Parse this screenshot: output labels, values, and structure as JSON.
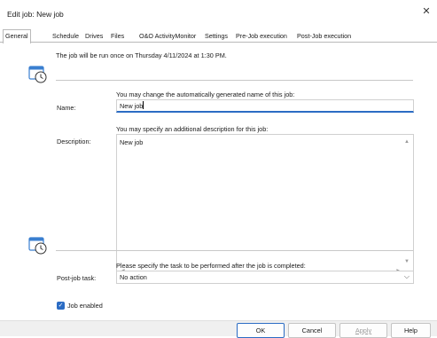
{
  "window": {
    "title": "Edit job: New job",
    "close_glyph": "✕"
  },
  "tabs": [
    {
      "label": "General",
      "active": true
    },
    {
      "label": "Schedule"
    },
    {
      "label": "Drives"
    },
    {
      "label": "Files"
    },
    {
      "label": "O&O ActivityMonitor"
    },
    {
      "label": "Settings"
    },
    {
      "label": "Pre-Job execution"
    },
    {
      "label": "Post-Job execution"
    }
  ],
  "general": {
    "run_info": "The job will be run once on Thursday 4/11/2024 at 1:30 PM.",
    "name_hint": "You may change the automatically generated name of this job:",
    "name_label": "Name:",
    "name_value": "New job",
    "desc_hint": "You may specify an additional description for this job:",
    "desc_label": "Description:",
    "desc_value": "New job",
    "post_hint": "Please specify the task to be performed after the job is completed:",
    "post_label": "Post-job task:",
    "post_value": "No action",
    "job_enabled_label": "Job enabled",
    "job_enabled_checked": true
  },
  "icons": {
    "schedule_icon": "calendar-clock-icon",
    "post_icon": "calendar-clock-icon",
    "accent": "#2b6cc4"
  },
  "buttons": {
    "ok": "OK",
    "cancel": "Cancel",
    "apply": "Apply",
    "help": "Help"
  }
}
